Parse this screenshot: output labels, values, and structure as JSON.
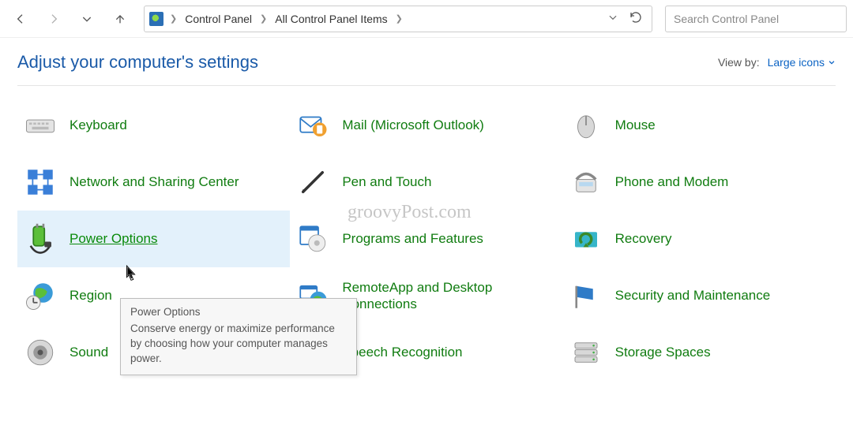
{
  "breadcrumb": {
    "root": "Control Panel",
    "sub": "All Control Panel Items"
  },
  "search": {
    "placeholder": "Search Control Panel"
  },
  "header": {
    "title": "Adjust your computer's settings",
    "viewby_label": "View by:",
    "viewby_mode": "Large icons"
  },
  "items": {
    "keyboard": "Keyboard",
    "mail": "Mail (Microsoft Outlook)",
    "mouse": "Mouse",
    "network": "Network and Sharing Center",
    "pen": "Pen and Touch",
    "phone": "Phone and Modem",
    "power": "Power Options",
    "programs": "Programs and Features",
    "recovery": "Recovery",
    "region": "Region",
    "remoteapp": "RemoteApp and Desktop Connections",
    "security": "Security and Maintenance",
    "sound": "Sound",
    "speech": "Speech Recognition",
    "storage": "Storage Spaces"
  },
  "tooltip": {
    "title": "Power Options",
    "body": "Conserve energy or maximize performance by choosing how your computer manages power."
  },
  "watermark": "groovyPost.com"
}
